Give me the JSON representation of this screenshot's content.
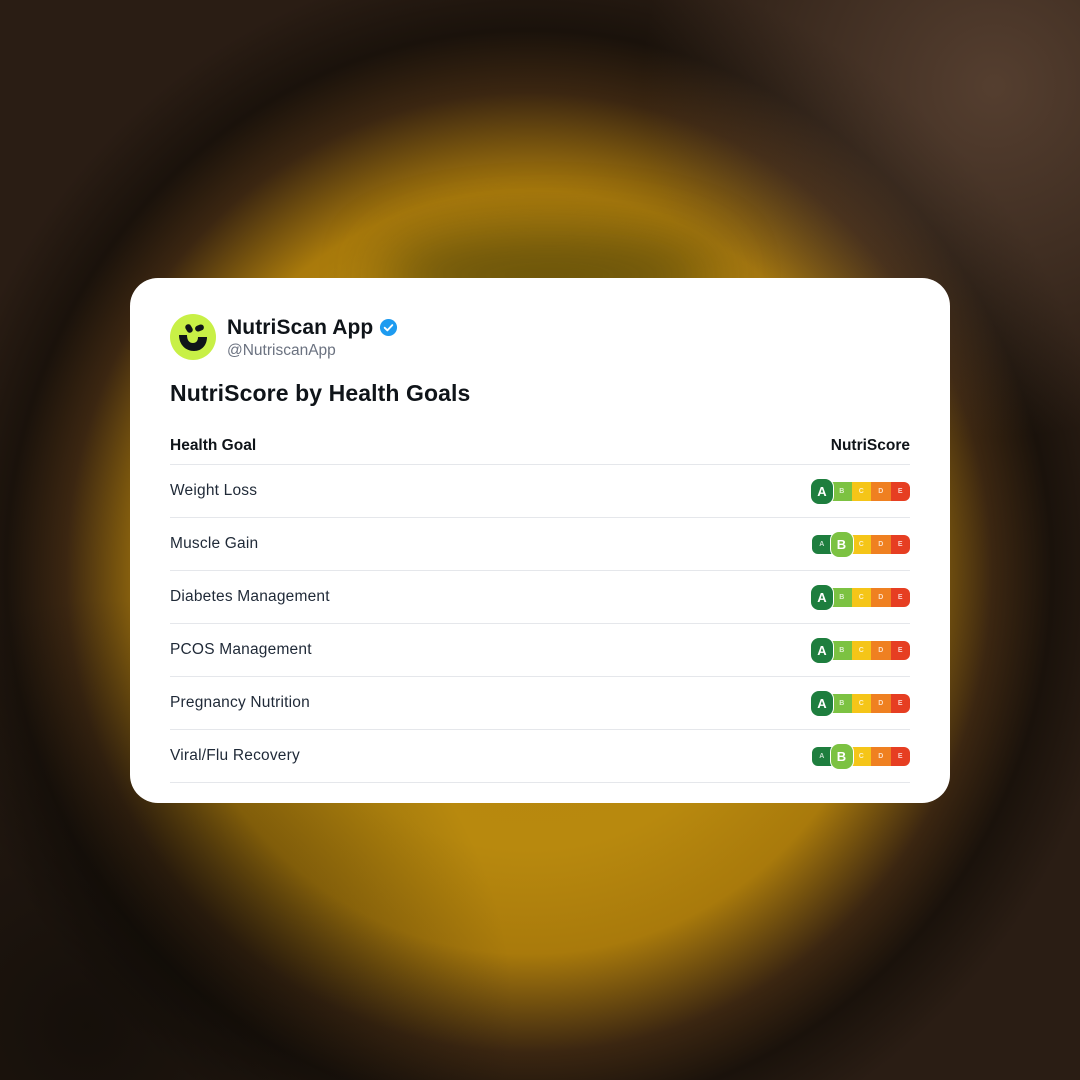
{
  "profile": {
    "name": "NutriScan App",
    "handle": "@NutriscanApp",
    "avatar_icon": "nutriscan-logo-icon",
    "verified_icon": "verified-badge-icon",
    "avatar_color": "#c8f046",
    "verified_color": "#1d9bf0"
  },
  "title": "NutriScore by Health Goals",
  "table": {
    "columns": [
      "Health Goal",
      "NutriScore"
    ],
    "grades": [
      "A",
      "B",
      "C",
      "D",
      "E"
    ],
    "grade_colors": [
      "#1e7e3e",
      "#7cc242",
      "#f5c518",
      "#ef8021",
      "#e63e22"
    ],
    "rows": [
      {
        "goal": "Weight Loss",
        "score": "A"
      },
      {
        "goal": "Muscle Gain",
        "score": "B"
      },
      {
        "goal": "Diabetes Management",
        "score": "A"
      },
      {
        "goal": "PCOS Management",
        "score": "A"
      },
      {
        "goal": "Pregnancy Nutrition",
        "score": "A"
      },
      {
        "goal": "Viral/Flu Recovery",
        "score": "B"
      }
    ]
  }
}
